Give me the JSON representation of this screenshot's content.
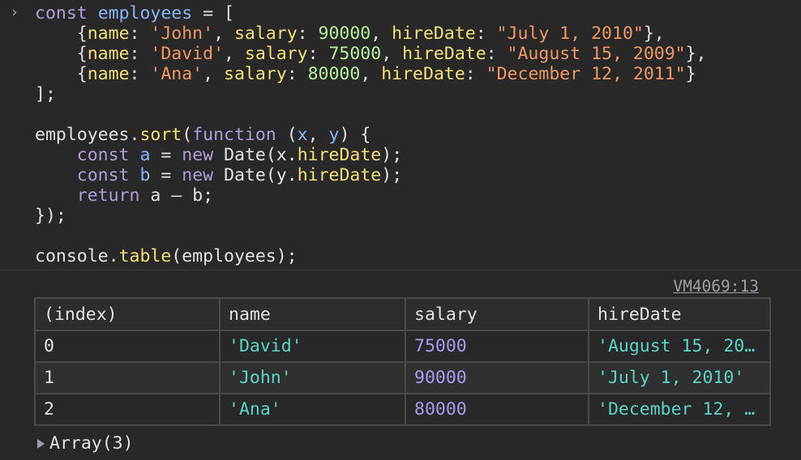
{
  "prompt_symbol": "›",
  "code": {
    "line1": {
      "kw": "const",
      "var": "employees",
      "rest": " = ["
    },
    "employees": [
      {
        "name": "'John'",
        "salary": "90000",
        "hireDate": "\"July 1, 2010\"",
        "end": "},"
      },
      {
        "name": "'David'",
        "salary": "75000",
        "hireDate": "\"August 15, 2009\"",
        "end": "},"
      },
      {
        "name": "'Ana'",
        "salary": "80000",
        "hireDate": "\"December 12, 2011\"",
        "end": "}"
      }
    ],
    "keys": {
      "name": "name",
      "salary": "salary",
      "hireDate": "hireDate"
    },
    "close_array": "];",
    "sort_obj": "employees",
    "sort_method": "sort",
    "function_kw": "function",
    "param_x": "x",
    "param_y": "y",
    "const_kw": "const",
    "new_kw": "new",
    "return_kw": "return",
    "date_ctor": "Date",
    "a": "a",
    "b": "b",
    "close_fn": "});",
    "console_obj": "console",
    "console_method": "table",
    "console_arg": "(employees);"
  },
  "source_link": "VM4069:13",
  "table": {
    "headers": [
      "(index)",
      "name",
      "salary",
      "hireDate"
    ],
    "rows": [
      {
        "index": "0",
        "name": "'David'",
        "salary": "75000",
        "hireDate": "'August 15, 20…"
      },
      {
        "index": "1",
        "name": "'John'",
        "salary": "90000",
        "hireDate": "'July 1, 2010'"
      },
      {
        "index": "2",
        "name": "'Ana'",
        "salary": "80000",
        "hireDate": "'December 12, …"
      }
    ]
  },
  "array_label": "Array(3)",
  "colors": {
    "keyword": "#b39ddb",
    "variable": "#8ab4f8",
    "property": "#f2e07a",
    "string": "#f29766",
    "number": "#b8f0a0",
    "table_string": "#5cd5c6",
    "table_number": "#a99bf5",
    "background": "#282828"
  }
}
